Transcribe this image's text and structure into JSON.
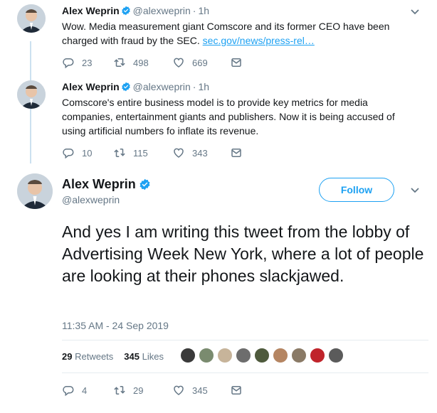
{
  "tweets": [
    {
      "name": "Alex Weprin",
      "handle": "@alexweprin",
      "dot": "·",
      "time": "1h",
      "text": "Wow. Media measurement giant Comscore and its former CEO have been charged with fraud by the SEC.",
      "link": "sec.gov/news/press-rel…",
      "replies": "23",
      "retweets": "498",
      "likes": "669"
    },
    {
      "name": "Alex Weprin",
      "handle": "@alexweprin",
      "dot": "·",
      "time": "1h",
      "text": "Comscore's entire business model is to provide key metrics for media companies, entertainment giants and publishers. Now it is being accused of using artificial numbers fo inflate its revenue.",
      "replies": "10",
      "retweets": "115",
      "likes": "343"
    }
  ],
  "main": {
    "name": "Alex Weprin",
    "handle": "@alexweprin",
    "follow_label": "Follow",
    "text": "And yes I am writing this tweet from the lobby of Advertising Week New York, where a lot of people are looking at their phones slackjawed.",
    "timestamp": "11:35 AM - 24 Sep 2019",
    "retweets_count": "29",
    "retweets_label": "Retweets",
    "likes_count": "345",
    "likes_label": "Likes",
    "replies": "4",
    "retweets": "29",
    "likes": "345"
  },
  "colors": {
    "accent": "#1da1f2",
    "secondary_text": "#657786",
    "thread_line": "#cce1f0"
  },
  "icons": [
    "verified-badge-icon",
    "chevron-down-icon",
    "reply-icon",
    "retweet-icon",
    "like-icon",
    "direct-message-icon"
  ]
}
